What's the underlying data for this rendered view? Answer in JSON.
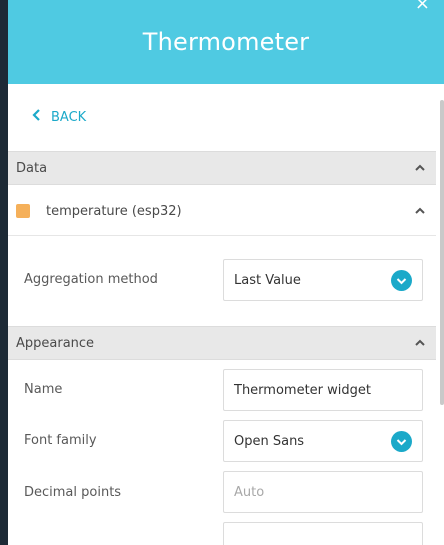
{
  "header": {
    "title": "Thermometer",
    "close_glyph": "×"
  },
  "back": {
    "label": "BACK"
  },
  "data_section": {
    "title": "Data",
    "datasource": {
      "label": "temperature (esp32)",
      "color": "#f5b05a"
    },
    "aggregation": {
      "label": "Aggregation method",
      "value": "Last Value"
    }
  },
  "appearance_section": {
    "title": "Appearance",
    "name": {
      "label": "Name",
      "value": "Thermometer widget"
    },
    "font_family": {
      "label": "Font family",
      "value": "Open Sans"
    },
    "decimal_points": {
      "label": "Decimal points",
      "placeholder": "Auto"
    }
  },
  "colors": {
    "accent": "#1ba9c9",
    "header": "#4fcae2"
  }
}
